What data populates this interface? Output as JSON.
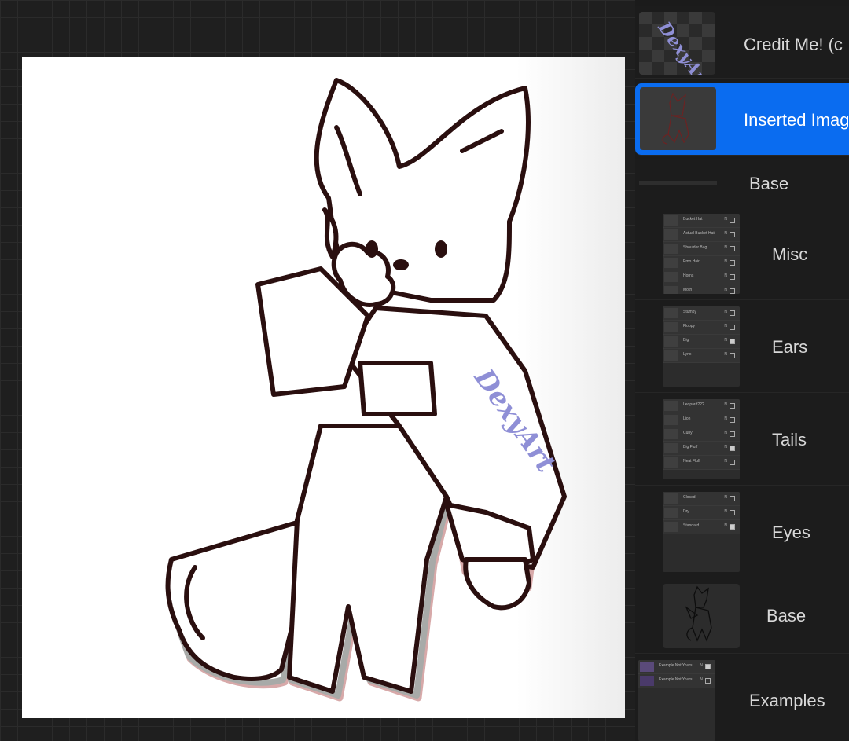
{
  "canvas": {
    "watermark": "DexyArt",
    "background": "#ffffff",
    "line_color": "#2a0f0f"
  },
  "layers_panel": {
    "layers": [
      {
        "name": "Credit Me! (c",
        "thumb": "watermark",
        "selected": false
      },
      {
        "name": "Inserted Imag",
        "thumb": "sketch",
        "selected": true
      },
      {
        "name": "Base",
        "thumb": "none",
        "selected": false
      },
      {
        "name": "Misc",
        "thumb": "group",
        "selected": false,
        "sublayers": [
          "Bucket Hat",
          "Actual Bucket Hat",
          "Shoulder Bag",
          "Emo Hair",
          "Horns",
          "Moth"
        ]
      },
      {
        "name": "Ears",
        "thumb": "group",
        "selected": false,
        "sublayers": [
          "Stumpy",
          "Floppy",
          "Big",
          "Lynx"
        ]
      },
      {
        "name": "Tails",
        "thumb": "group",
        "selected": false,
        "sublayers": [
          "Leopard???",
          "Lion",
          "Curly",
          "Big Fluff",
          "Neat Fluff"
        ]
      },
      {
        "name": "Eyes",
        "thumb": "group",
        "selected": false,
        "sublayers": [
          "Closed",
          "Dry",
          "Standard"
        ]
      },
      {
        "name": "Base",
        "thumb": "sketch",
        "selected": false
      },
      {
        "name": "Examples",
        "thumb": "group",
        "selected": false,
        "sublayers": [
          "Example Not Yours",
          "Example Not Yours"
        ]
      }
    ]
  },
  "colors": {
    "accent": "#0a6cf0",
    "panel_bg": "#1b1b1b",
    "watermark": "#8f8fd6"
  }
}
